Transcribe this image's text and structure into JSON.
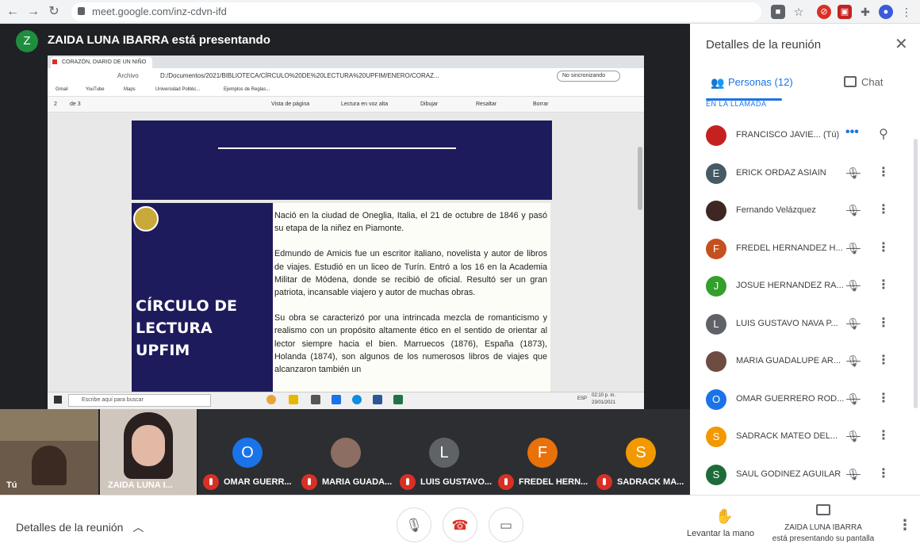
{
  "browser": {
    "url": "meet.google.com/inz-cdvn-ifd"
  },
  "meet": {
    "presenter_initial": "Z",
    "presenter_banner": "ZAIDA LUNA IBARRA está presentando"
  },
  "shared_screen": {
    "tab_title": "CORAZÓN, DIARIO DE UN NIÑO",
    "url": "D:/Documentos/2021/BIBLIOTECA/CÍRCULO%20DE%20LECTURA%20UPFIM/ENERO/CORAZ...",
    "url_prefix": "Archivo",
    "sync_label": "No sincronizando",
    "bookmarks": [
      "Gmail",
      "YouTube",
      "Maps",
      "Universidad Politéc...",
      "Ejemplos de Reglas..."
    ],
    "page_indicator": "2",
    "page_of": "de 3",
    "toolbar": [
      "Vista de página",
      "Lectura en voz alta",
      "Dibujar",
      "Resaltar",
      "Borrar"
    ],
    "cover_title": "CÍRCULO DE LECTURA UPFIM",
    "paragraphs": [
      "Nació en la ciudad de Oneglia, Italia, el 21 de octubre de 1846 y pasó su etapa de la niñez en Piamonte.",
      "Edmundo de Amicis fue un escritor italiano, novelista y autor de libros de viajes. Estudió en un liceo de Turín. Entró a los 16 en la Academia Militar de Módena, donde se recibió de oficial. Resultó ser un gran patriota, incansable viajero y autor de muchas obras.",
      "Su obra se caracterizó por una intrincada mezcla de romanticismo y realismo con un propósito altamente ético en el sentido de orientar al lector siempre hacia el bien. Marruecos (1876), España (1873), Holanda (1874), son algunos de los numerosos libros de viajes que alcanzaron también un"
    ],
    "taskbar_search": "Escribe aquí para buscar",
    "taskbar_lang": "ESP",
    "taskbar_time": "02:10 p. m.",
    "taskbar_date": "23/01/2021"
  },
  "tiles": [
    {
      "name": "Tú"
    },
    {
      "name": "ZAIDA LUNA I..."
    },
    {
      "initial": "O",
      "name": "OMAR GUERR...",
      "color": "#1a73e8"
    },
    {
      "initial": "",
      "name": "MARIA GUADA...",
      "color": "#8d6e63"
    },
    {
      "initial": "L",
      "name": "LUIS GUSTAVO...",
      "color": "#5f6368"
    },
    {
      "initial": "F",
      "name": "FREDEL HERN...",
      "color": "#e8710a"
    },
    {
      "initial": "S",
      "name": "SADRACK MA...",
      "color": "#f29900"
    }
  ],
  "panel": {
    "title": "Detalles de la reunión",
    "tab_people": "Personas (12)",
    "tab_chat": "Chat",
    "section_label": "EN LA LLAMADA",
    "me_suffix": "(Tú)",
    "participants": [
      {
        "initial": "",
        "name": "FRANCISCO JAVIE...",
        "color": "#c5221f",
        "me": true
      },
      {
        "initial": "E",
        "name": "ERICK ORDAZ ASIAIN",
        "color": "#455a64"
      },
      {
        "initial": "",
        "name": "Fernando Velázquez",
        "color": "#3e2723"
      },
      {
        "initial": "F",
        "name": "FREDEL HERNANDEZ H...",
        "color": "#c5501f"
      },
      {
        "initial": "J",
        "name": "JOSUE HERNANDEZ RA...",
        "color": "#33a02c"
      },
      {
        "initial": "L",
        "name": "LUIS GUSTAVO NAVA P...",
        "color": "#5f6368"
      },
      {
        "initial": "",
        "name": "MARIA GUADALUPE AR...",
        "color": "#6d4c41"
      },
      {
        "initial": "O",
        "name": "OMAR GUERRERO ROD...",
        "color": "#1a73e8"
      },
      {
        "initial": "S",
        "name": "SADRACK MATEO DEL...",
        "color": "#f29900"
      },
      {
        "initial": "S",
        "name": "SAUL GODINEZ AGUILAR",
        "color": "#1e6b3a"
      }
    ]
  },
  "bottom_bar": {
    "details_label": "Detalles de la reunión",
    "raise_hand": "Levantar la mano",
    "presenting_line1": "ZAIDA LUNA IBARRA",
    "presenting_line2": "está presentando su pantalla"
  },
  "colors": {
    "accent": "#1a73e8",
    "danger": "#d93025",
    "cover_navy": "#1e1b5c"
  }
}
